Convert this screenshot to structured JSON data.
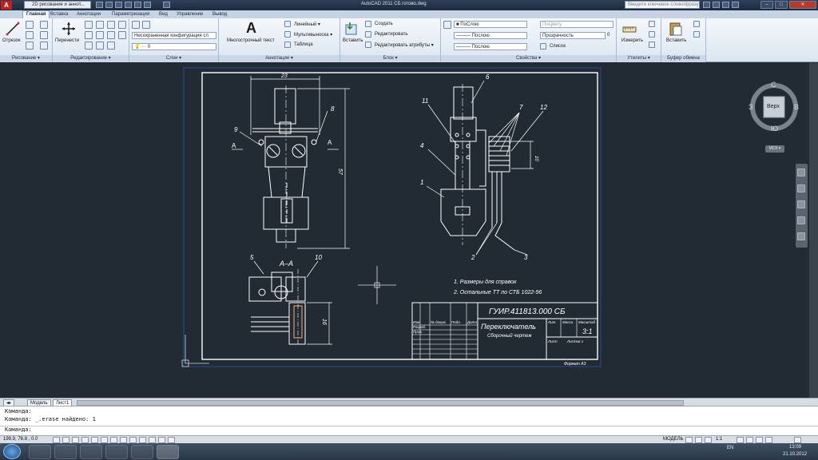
{
  "titlebar": {
    "workspace": "2D рисование и аннот...",
    "title": "AutoCAD 2011   СБ готово.dwg",
    "search_placeholder": "Введите ключевое слово/фразу",
    "minimize": "–",
    "maximize": "□",
    "close": "✕"
  },
  "ribbon_tabs": [
    "Главная",
    "Вставка",
    "Аннотации",
    "Параметризация",
    "Вид",
    "Управление",
    "Вывод"
  ],
  "panels": {
    "draw": {
      "label": "Рисование ▾",
      "line_label": "Отрезок"
    },
    "modify": {
      "label": "Редактирование ▾",
      "move_label": "Перенести"
    },
    "layers": {
      "label": "Слои ▾",
      "layer_state": "Несохраненная конфигурация сл",
      "current_layer": "0"
    },
    "annotation": {
      "label": "Аннотации ▾",
      "mtext_label": "Многострочный текст",
      "linear": "Линейный ▾",
      "multileader": "Мультивыноска ▾",
      "table": "Таблица"
    },
    "block": {
      "label": "Блок ▾",
      "insert": "Вставить",
      "create": "Создать",
      "edit": "Редактировать",
      "edit_attr": "Редактировать атрибуты ▾"
    },
    "properties": {
      "label": "Свойства ▾",
      "color": "ПоСлою",
      "linetype": "Послою",
      "lineweight": "Послою",
      "plotstyle": "ПоЦвету",
      "transparency_label": "Прозрачность",
      "transparency_value": "0",
      "list": "Список"
    },
    "utilities": {
      "label": "Утилиты ▾",
      "measure": "Измерить"
    },
    "clipboard": {
      "label": "Буфер обмена",
      "paste": "Вставить"
    }
  },
  "viewcube": {
    "north": "С",
    "south": "Ю",
    "west": "З",
    "east": "В",
    "face": "Верх",
    "ucs": "МСК ▾"
  },
  "drawing": {
    "dims": {
      "d23": "23",
      "d8": "8",
      "d9": "9",
      "d57": "57",
      "d6": "6",
      "d7": "7",
      "d11": "11",
      "d12": "12",
      "d10": "10",
      "d4": "4",
      "d1": "1",
      "d2": "2",
      "d3": "3",
      "d5": "5",
      "d16": "16"
    },
    "section_left": "A",
    "section_right": "A",
    "section_title": "А–А",
    "notes": [
      "1. Размеры для справок",
      "2. Остальные ТТ по СТБ 1022-96"
    ],
    "titleblock": {
      "code": "ГУИР.411813.000 СБ",
      "name": "Переключатель",
      "subtitle": "Сборочный чертеж",
      "scale": "3:1",
      "lit": "Лит.",
      "mass": "Масса",
      "masshtab": "Масштаб",
      "izm": "Изм.",
      "list": "Лист",
      "ndoc": "№ докум.",
      "podp": "Подп.",
      "data": "Дата",
      "razrab": "Разраб.",
      "prov": "Пров.",
      "list2": "Лист",
      "listov": "Листов 1"
    },
    "format": "Формат А3"
  },
  "layout_tabs": [
    "Модель",
    "Лист1"
  ],
  "command": {
    "line1": "Команда:",
    "line2": "Команда: _.erase найдено: 1",
    "prompt": "Команда:"
  },
  "status": {
    "coords": "199.9, 76.8 , 0.0",
    "model": "МОДЕЛЬ",
    "scale": "1:1"
  },
  "taskbar": {
    "lang": "EN",
    "time": "13:09",
    "date": "21.10.2012"
  }
}
